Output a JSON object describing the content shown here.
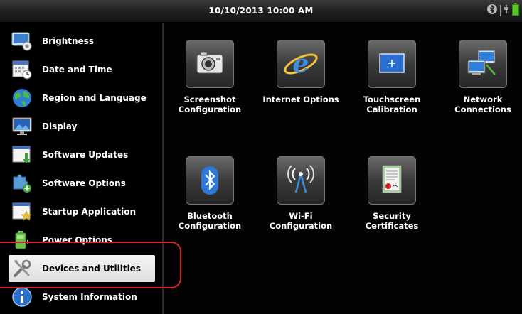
{
  "status_bar": {
    "datetime": "10/10/2013 10:00 AM",
    "icons": [
      "bluetooth-icon",
      "power-plug-icon",
      "battery-icon"
    ]
  },
  "sidebar": {
    "items": [
      {
        "label": "Brightness",
        "icon": "brightness-icon"
      },
      {
        "label": "Date and Time",
        "icon": "calendar-clock-icon"
      },
      {
        "label": "Region and Language",
        "icon": "globe-icon"
      },
      {
        "label": "Display",
        "icon": "monitor-icon"
      },
      {
        "label": "Software Updates",
        "icon": "software-update-icon"
      },
      {
        "label": "Software Options",
        "icon": "puzzle-add-icon"
      },
      {
        "label": "Startup Application",
        "icon": "startup-window-star-icon"
      },
      {
        "label": "Power Options",
        "icon": "battery-power-icon"
      },
      {
        "label": "Devices and Utilities",
        "icon": "tools-icon",
        "selected": true
      },
      {
        "label": "System Information",
        "icon": "info-icon"
      }
    ]
  },
  "main": {
    "tiles": [
      {
        "label_line1": "Screenshot",
        "label_line2": "Configuration",
        "icon": "camera-icon"
      },
      {
        "label_line1": "Internet Options",
        "label_line2": "",
        "icon": "internet-explorer-icon"
      },
      {
        "label_line1": "Touchscreen",
        "label_line2": "Calibration",
        "icon": "touchscreen-crosshair-icon"
      },
      {
        "label_line1": "Network",
        "label_line2": "Connections",
        "icon": "network-computers-icon"
      },
      {
        "label_line1": "Bluetooth",
        "label_line2": "Configuration",
        "icon": "bluetooth-icon"
      },
      {
        "label_line1": "Wi-Fi",
        "label_line2": "Configuration",
        "icon": "wifi-antenna-icon"
      },
      {
        "label_line1": "Security",
        "label_line2": "Certificates",
        "icon": "certificate-icon"
      }
    ]
  },
  "colors": {
    "highlight_ring": "#d8232a",
    "background": "#050505",
    "selected_item_bg": "#e8e8e8"
  }
}
